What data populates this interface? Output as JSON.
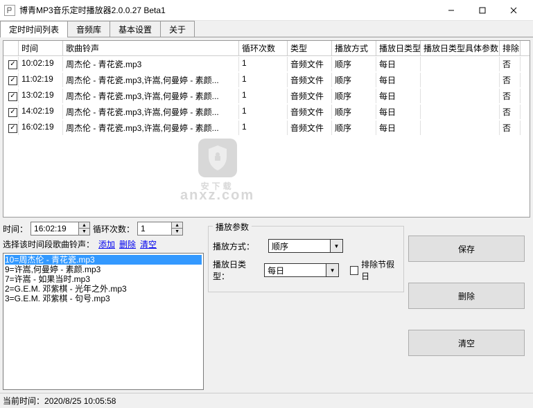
{
  "window": {
    "title": "博青MP3音乐定时播放器2.0.0.27 Beta1"
  },
  "tabs": [
    "定时时间列表",
    "音频库",
    "基本设置",
    "关于"
  ],
  "list": {
    "headers": [
      "时间",
      "歌曲铃声",
      "循环次数",
      "类型",
      "播放方式",
      "播放日类型",
      "播放日类型具体参数",
      "排除"
    ],
    "rows": [
      {
        "checked": true,
        "time": "10:02:19",
        "song": "周杰伦 - 青花瓷.mp3",
        "loop": "1",
        "type": "音频文件",
        "pmode": "顺序",
        "daytype": "每日",
        "dayparam": "",
        "exc": "否"
      },
      {
        "checked": true,
        "time": "11:02:19",
        "song": "周杰伦 - 青花瓷.mp3,许嵩,何曼婷 - 素颜...",
        "loop": "1",
        "type": "音频文件",
        "pmode": "顺序",
        "daytype": "每日",
        "dayparam": "",
        "exc": "否"
      },
      {
        "checked": true,
        "time": "13:02:19",
        "song": "周杰伦 - 青花瓷.mp3,许嵩,何曼婷 - 素颜...",
        "loop": "1",
        "type": "音频文件",
        "pmode": "顺序",
        "daytype": "每日",
        "dayparam": "",
        "exc": "否"
      },
      {
        "checked": true,
        "time": "14:02:19",
        "song": "周杰伦 - 青花瓷.mp3,许嵩,何曼婷 - 素颜...",
        "loop": "1",
        "type": "音频文件",
        "pmode": "顺序",
        "daytype": "每日",
        "dayparam": "",
        "exc": "否"
      },
      {
        "checked": true,
        "time": "16:02:19",
        "song": "周杰伦 - 青花瓷.mp3,许嵩,何曼婷 - 素颜...",
        "loop": "1",
        "type": "音频文件",
        "pmode": "顺序",
        "daytype": "每日",
        "dayparam": "",
        "exc": "否"
      }
    ]
  },
  "lower_left": {
    "time_label": "时间：",
    "time_value": "16:02:19",
    "loop_label": "循环次数：",
    "loop_value": "1",
    "select_label": "选择该时间段歌曲铃声：",
    "add": "添加",
    "delete": "删除",
    "clear": "清空",
    "songs": [
      "10=周杰伦 - 青花瓷.mp3",
      "9=许嵩,何曼婷 - 素颜.mp3",
      "7=许嵩 - 如果当时.mp3",
      "2=G.E.M. 邓紫棋 - 光年之外.mp3",
      "3=G.E.M. 邓紫棋 - 句号.mp3"
    ]
  },
  "lower_mid": {
    "fieldset_title": "播放参数",
    "pmode_label": "播放方式：",
    "pmode_value": "顺序",
    "daytype_label": "播放日类型：",
    "daytype_value": "每日",
    "exclude_label": "排除节假日"
  },
  "buttons": {
    "save": "保存",
    "delete": "删除",
    "clear": "清空"
  },
  "statusbar": {
    "label": "当前时间：",
    "value": "2020/8/25 10:05:58"
  },
  "watermark": {
    "main": "安下载",
    "sub": "anxz.com"
  }
}
